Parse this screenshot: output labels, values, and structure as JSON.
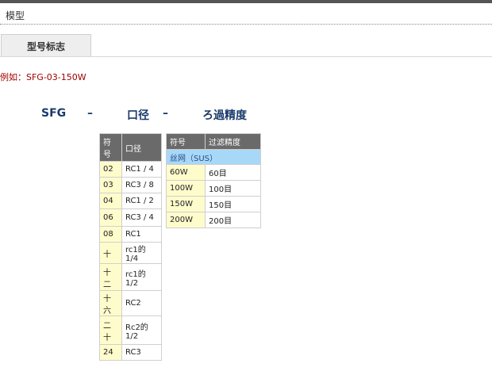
{
  "section_title": "模型",
  "tab_label": "型号标志",
  "example": "例如：SFG-03-150W",
  "codes": {
    "series": "SFG",
    "dash1": "–",
    "port": "口径",
    "dash2": "–",
    "filter": "ろ過精度"
  },
  "port_table": {
    "headers": [
      "符号",
      "口径"
    ],
    "rows": [
      {
        "code": "02",
        "value": "RC1 / 4",
        "h": 20
      },
      {
        "code": "03",
        "value": "RC3 / 8",
        "h": 20
      },
      {
        "code": "04",
        "value": "RC1 / 2",
        "h": 20
      },
      {
        "code": "06",
        "value": "RC3 / 4",
        "h": 22
      },
      {
        "code": "08",
        "value": "RC1",
        "h": 20
      },
      {
        "code": "十",
        "value": "rc1的1/4",
        "h": 20
      },
      {
        "code": "十二",
        "value": "rc1的1/2",
        "h": 34
      },
      {
        "code": "十六",
        "value": "RC2",
        "h": 32
      },
      {
        "code": "二十",
        "value": "Rc2的1/2",
        "h": 36
      },
      {
        "code": "24",
        "value": "RC3",
        "h": 20
      }
    ]
  },
  "filter_table": {
    "headers": [
      "符号",
      "过滤精度"
    ],
    "group": "丝网（SUS）",
    "rows": [
      {
        "code": "60W",
        "value": "60目"
      },
      {
        "code": "100W",
        "value": "100目"
      },
      {
        "code": "150W",
        "value": "150目"
      },
      {
        "code": "200W",
        "value": "200目"
      }
    ]
  }
}
